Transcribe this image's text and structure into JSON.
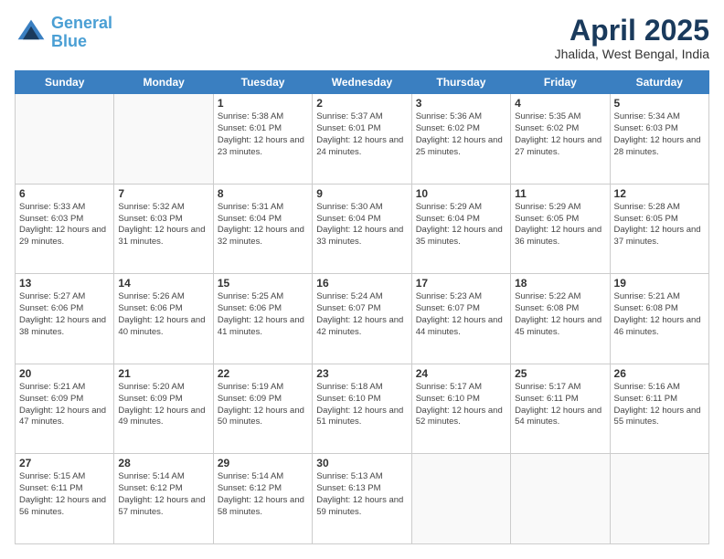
{
  "header": {
    "logo_line1": "General",
    "logo_line2": "Blue",
    "month": "April 2025",
    "location": "Jhalida, West Bengal, India"
  },
  "days_of_week": [
    "Sunday",
    "Monday",
    "Tuesday",
    "Wednesday",
    "Thursday",
    "Friday",
    "Saturday"
  ],
  "weeks": [
    [
      {
        "day": "",
        "info": ""
      },
      {
        "day": "",
        "info": ""
      },
      {
        "day": "1",
        "info": "Sunrise: 5:38 AM\nSunset: 6:01 PM\nDaylight: 12 hours and 23 minutes."
      },
      {
        "day": "2",
        "info": "Sunrise: 5:37 AM\nSunset: 6:01 PM\nDaylight: 12 hours and 24 minutes."
      },
      {
        "day": "3",
        "info": "Sunrise: 5:36 AM\nSunset: 6:02 PM\nDaylight: 12 hours and 25 minutes."
      },
      {
        "day": "4",
        "info": "Sunrise: 5:35 AM\nSunset: 6:02 PM\nDaylight: 12 hours and 27 minutes."
      },
      {
        "day": "5",
        "info": "Sunrise: 5:34 AM\nSunset: 6:03 PM\nDaylight: 12 hours and 28 minutes."
      }
    ],
    [
      {
        "day": "6",
        "info": "Sunrise: 5:33 AM\nSunset: 6:03 PM\nDaylight: 12 hours and 29 minutes."
      },
      {
        "day": "7",
        "info": "Sunrise: 5:32 AM\nSunset: 6:03 PM\nDaylight: 12 hours and 31 minutes."
      },
      {
        "day": "8",
        "info": "Sunrise: 5:31 AM\nSunset: 6:04 PM\nDaylight: 12 hours and 32 minutes."
      },
      {
        "day": "9",
        "info": "Sunrise: 5:30 AM\nSunset: 6:04 PM\nDaylight: 12 hours and 33 minutes."
      },
      {
        "day": "10",
        "info": "Sunrise: 5:29 AM\nSunset: 6:04 PM\nDaylight: 12 hours and 35 minutes."
      },
      {
        "day": "11",
        "info": "Sunrise: 5:29 AM\nSunset: 6:05 PM\nDaylight: 12 hours and 36 minutes."
      },
      {
        "day": "12",
        "info": "Sunrise: 5:28 AM\nSunset: 6:05 PM\nDaylight: 12 hours and 37 minutes."
      }
    ],
    [
      {
        "day": "13",
        "info": "Sunrise: 5:27 AM\nSunset: 6:06 PM\nDaylight: 12 hours and 38 minutes."
      },
      {
        "day": "14",
        "info": "Sunrise: 5:26 AM\nSunset: 6:06 PM\nDaylight: 12 hours and 40 minutes."
      },
      {
        "day": "15",
        "info": "Sunrise: 5:25 AM\nSunset: 6:06 PM\nDaylight: 12 hours and 41 minutes."
      },
      {
        "day": "16",
        "info": "Sunrise: 5:24 AM\nSunset: 6:07 PM\nDaylight: 12 hours and 42 minutes."
      },
      {
        "day": "17",
        "info": "Sunrise: 5:23 AM\nSunset: 6:07 PM\nDaylight: 12 hours and 44 minutes."
      },
      {
        "day": "18",
        "info": "Sunrise: 5:22 AM\nSunset: 6:08 PM\nDaylight: 12 hours and 45 minutes."
      },
      {
        "day": "19",
        "info": "Sunrise: 5:21 AM\nSunset: 6:08 PM\nDaylight: 12 hours and 46 minutes."
      }
    ],
    [
      {
        "day": "20",
        "info": "Sunrise: 5:21 AM\nSunset: 6:09 PM\nDaylight: 12 hours and 47 minutes."
      },
      {
        "day": "21",
        "info": "Sunrise: 5:20 AM\nSunset: 6:09 PM\nDaylight: 12 hours and 49 minutes."
      },
      {
        "day": "22",
        "info": "Sunrise: 5:19 AM\nSunset: 6:09 PM\nDaylight: 12 hours and 50 minutes."
      },
      {
        "day": "23",
        "info": "Sunrise: 5:18 AM\nSunset: 6:10 PM\nDaylight: 12 hours and 51 minutes."
      },
      {
        "day": "24",
        "info": "Sunrise: 5:17 AM\nSunset: 6:10 PM\nDaylight: 12 hours and 52 minutes."
      },
      {
        "day": "25",
        "info": "Sunrise: 5:17 AM\nSunset: 6:11 PM\nDaylight: 12 hours and 54 minutes."
      },
      {
        "day": "26",
        "info": "Sunrise: 5:16 AM\nSunset: 6:11 PM\nDaylight: 12 hours and 55 minutes."
      }
    ],
    [
      {
        "day": "27",
        "info": "Sunrise: 5:15 AM\nSunset: 6:11 PM\nDaylight: 12 hours and 56 minutes."
      },
      {
        "day": "28",
        "info": "Sunrise: 5:14 AM\nSunset: 6:12 PM\nDaylight: 12 hours and 57 minutes."
      },
      {
        "day": "29",
        "info": "Sunrise: 5:14 AM\nSunset: 6:12 PM\nDaylight: 12 hours and 58 minutes."
      },
      {
        "day": "30",
        "info": "Sunrise: 5:13 AM\nSunset: 6:13 PM\nDaylight: 12 hours and 59 minutes."
      },
      {
        "day": "",
        "info": ""
      },
      {
        "day": "",
        "info": ""
      },
      {
        "day": "",
        "info": ""
      }
    ]
  ]
}
